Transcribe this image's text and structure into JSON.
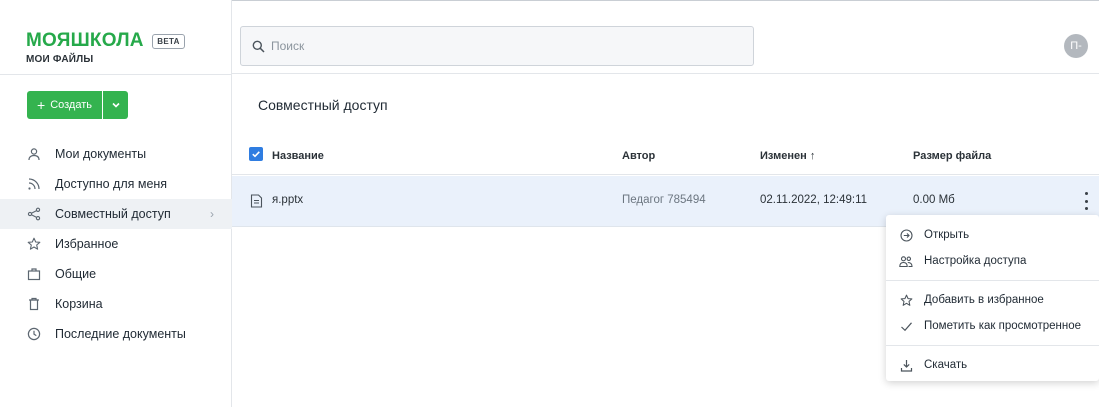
{
  "brand": {
    "logo": "МОЯШКОЛА",
    "badge": "BETA",
    "subtitle": "МОИ ФАЙЛЫ"
  },
  "create": {
    "label": "Создать",
    "icon": "plus-icon",
    "dropdown_icon": "chevron-down-icon"
  },
  "sidebar": {
    "items": [
      {
        "label": "Мои документы",
        "icon": "person-icon"
      },
      {
        "label": "Доступно для меня",
        "icon": "rss-icon"
      },
      {
        "label": "Совместный доступ",
        "icon": "share-icon",
        "active": true
      },
      {
        "label": "Избранное",
        "icon": "star-icon"
      },
      {
        "label": "Общие",
        "icon": "briefcase-icon"
      },
      {
        "label": "Корзина",
        "icon": "trash-icon"
      },
      {
        "label": "Последние документы",
        "icon": "clock-icon"
      }
    ]
  },
  "search": {
    "placeholder": "Поиск",
    "value": ""
  },
  "user": {
    "avatar": "П-"
  },
  "main": {
    "title": "Совместный доступ",
    "columns": {
      "name": "Название",
      "author": "Автор",
      "modified": "Изменен ↑",
      "size": "Размер файла"
    },
    "rows": [
      {
        "name": "я.pptx",
        "author": "Педагог 785494",
        "modified": "02.11.2022, 12:49:11",
        "size": "0.00 Мб"
      }
    ]
  },
  "context_menu": {
    "open": "Открыть",
    "access": "Настройка доступа",
    "favorite": "Добавить в избранное",
    "mark_viewed": "Пометить как просмотренное",
    "download": "Скачать"
  },
  "colors": {
    "brand_green": "#26a94a",
    "button_green": "#34b34f",
    "accent_blue": "#2f7de1",
    "row_highlight": "#eaf1fb"
  }
}
